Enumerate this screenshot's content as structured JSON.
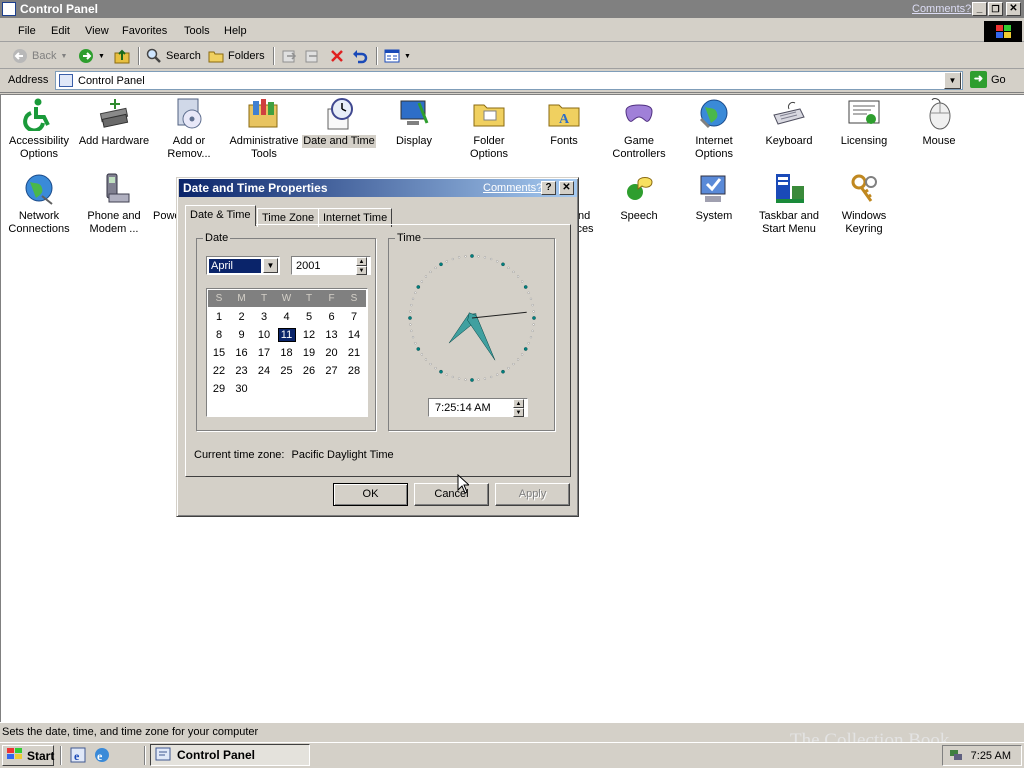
{
  "window": {
    "title": "Control Panel",
    "comments_link": "Comments?",
    "minimize": "_",
    "restore": "❐",
    "close": "✕"
  },
  "menu": [
    "File",
    "Edit",
    "View",
    "Favorites",
    "Tools",
    "Help"
  ],
  "toolbar": {
    "back": "Back",
    "search": "Search",
    "folders": "Folders"
  },
  "address": {
    "label": "Address",
    "value": "Control Panel",
    "go": "Go"
  },
  "items": [
    {
      "label": "Accessibility Options",
      "icon": "accessibility-icon"
    },
    {
      "label": "Add Hardware",
      "icon": "add-hardware-icon"
    },
    {
      "label": "Add or Remov...",
      "icon": "add-remove-programs-icon"
    },
    {
      "label": "Administrative Tools",
      "icon": "administrative-tools-icon"
    },
    {
      "label": "Date and Time",
      "icon": "date-time-icon"
    },
    {
      "label": "Display",
      "icon": "display-icon"
    },
    {
      "label": "Folder Options",
      "icon": "folder-options-icon"
    },
    {
      "label": "Fonts",
      "icon": "fonts-icon"
    },
    {
      "label": "Game Controllers",
      "icon": "game-controllers-icon"
    },
    {
      "label": "Internet Options",
      "icon": "internet-options-icon"
    },
    {
      "label": "Keyboard",
      "icon": "keyboard-icon"
    },
    {
      "label": "Licensing",
      "icon": "licensing-icon"
    },
    {
      "label": "Mouse",
      "icon": "mouse-icon"
    },
    {
      "label": "Network Connections",
      "icon": "network-icon"
    },
    {
      "label": "Phone and Modem ...",
      "icon": "phone-modem-icon"
    },
    {
      "label": "Powe",
      "icon": "power-icon"
    },
    {
      "label": "nd",
      "icon": "sounds-icon"
    },
    {
      "label": "ices",
      "icon": "sounds-icon-2"
    },
    {
      "label": "Speech",
      "icon": "speech-icon"
    },
    {
      "label": "System",
      "icon": "system-icon"
    },
    {
      "label": "Taskbar and Start Menu",
      "icon": "taskbar-icon"
    },
    {
      "label": "Windows Keyring",
      "icon": "keyring-icon"
    }
  ],
  "status": "Sets the date, time, and time zone for your computer",
  "taskbar": {
    "start": "Start",
    "active_window": "Control Panel",
    "clock": "7:25 AM"
  },
  "watermark": "The Collection Book",
  "dialog": {
    "title": "Date and Time Properties",
    "comments_link": "Comments?",
    "help": "?",
    "close": "✕",
    "tabs": [
      "Date & Time",
      "Time Zone",
      "Internet Time"
    ],
    "date_group": "Date",
    "time_group": "Time",
    "month": "April",
    "year": "2001",
    "weekdays": [
      "S",
      "M",
      "T",
      "W",
      "T",
      "F",
      "S"
    ],
    "days": [
      "1",
      "2",
      "3",
      "4",
      "5",
      "6",
      "7",
      "8",
      "9",
      "10",
      "11",
      "12",
      "13",
      "14",
      "15",
      "16",
      "17",
      "18",
      "19",
      "20",
      "21",
      "22",
      "23",
      "24",
      "25",
      "26",
      "27",
      "28",
      "29",
      "30"
    ],
    "first_weekday_index": 0,
    "selected_day": 11,
    "clock": {
      "hour": 7,
      "minute": 25,
      "second": 14
    },
    "time_value": "7:25:14 AM",
    "timezone_label": "Current time zone:",
    "timezone_value": "Pacific Daylight Time",
    "ok": "OK",
    "cancel": "Cancel",
    "apply": "Apply"
  }
}
